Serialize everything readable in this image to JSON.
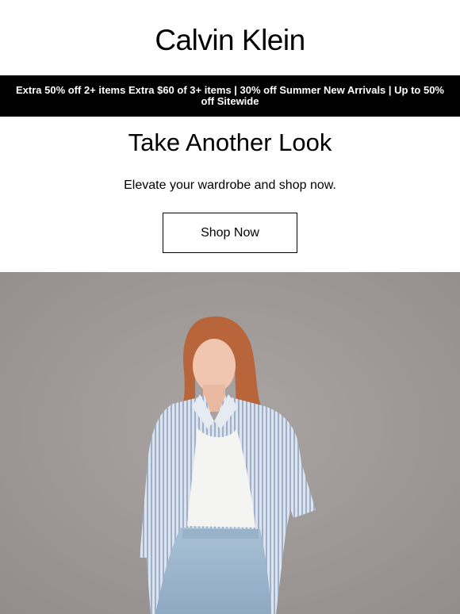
{
  "header": {
    "logo_text": "Calvin Klein"
  },
  "promo": {
    "text": "Extra 50% off 2+ items Extra $60 of 3+ items | 30% off Summer New Arrivals | Up to 50% off Sitewide"
  },
  "main": {
    "headline": "Take Another Look",
    "subline": "Elevate your wardrobe and shop now.",
    "cta_label": "Shop Now"
  },
  "colors": {
    "background": "#ffffff",
    "promo_bar": "#000000",
    "hero_backdrop": "#a19b99"
  }
}
